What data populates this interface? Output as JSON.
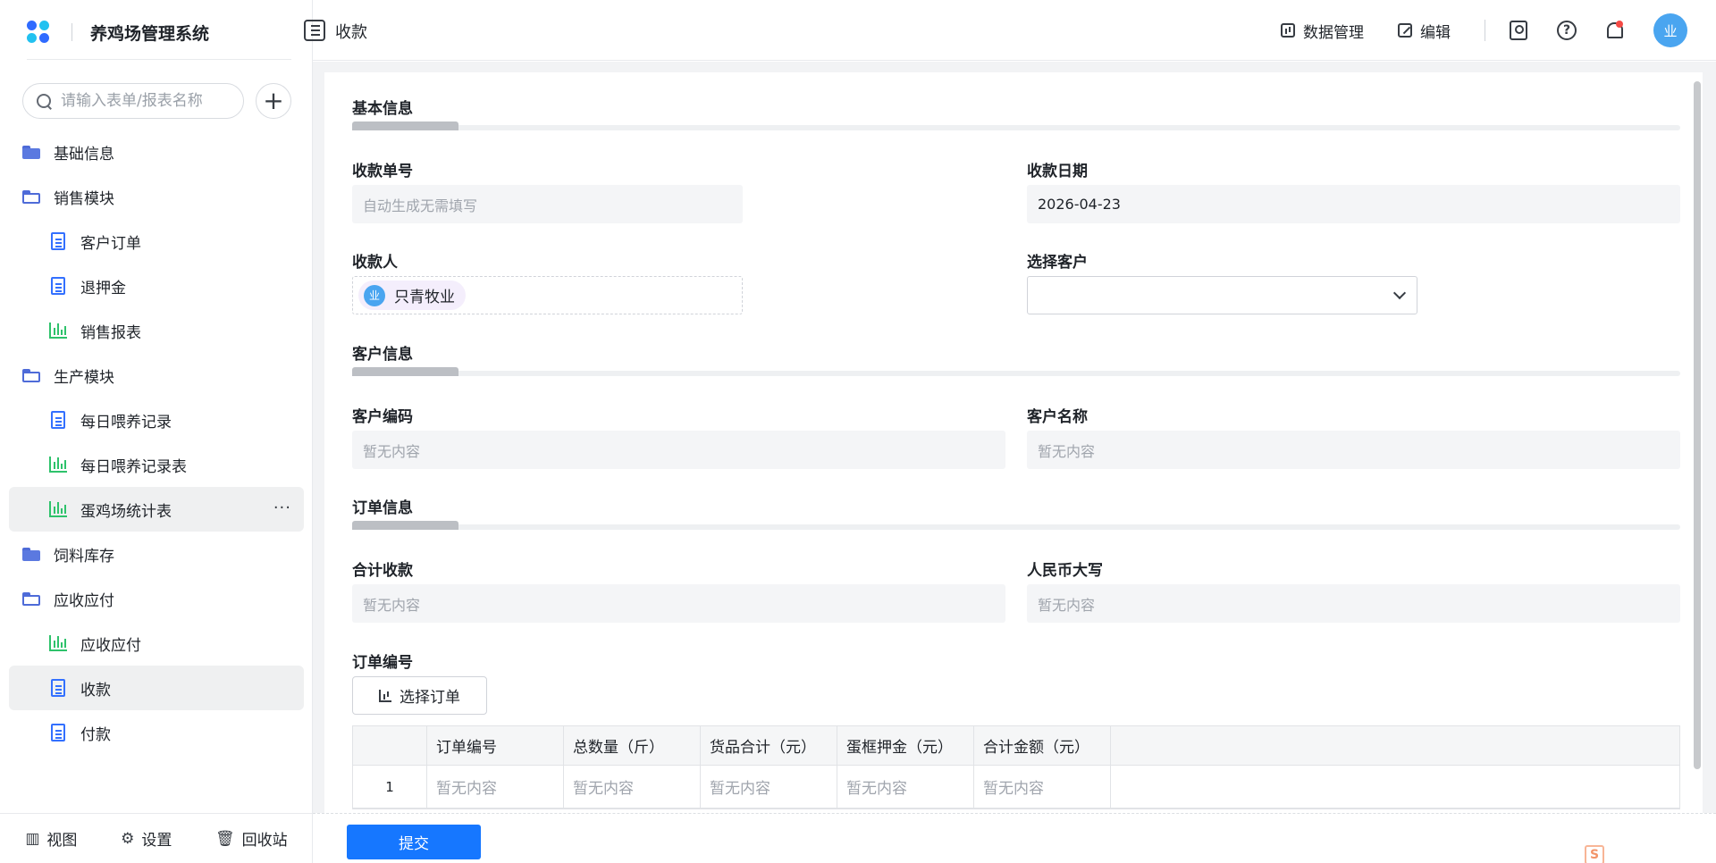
{
  "app": {
    "title": "养鸡场管理系统"
  },
  "search": {
    "placeholder": "请输入表单/报表名称"
  },
  "sidebar": {
    "items": [
      {
        "label": "基础信息",
        "level": 0,
        "icon": "folder-icon"
      },
      {
        "label": "销售模块",
        "level": 0,
        "icon": "folder-open-icon"
      },
      {
        "label": "客户订单",
        "level": 1,
        "icon": "form-doc-icon"
      },
      {
        "label": "退押金",
        "level": 1,
        "icon": "form-doc-icon"
      },
      {
        "label": "销售报表",
        "level": 1,
        "icon": "report-chart-icon"
      },
      {
        "label": "生产模块",
        "level": 0,
        "icon": "folder-open-icon"
      },
      {
        "label": "每日喂养记录",
        "level": 1,
        "icon": "form-doc-icon"
      },
      {
        "label": "每日喂养记录表",
        "level": 1,
        "icon": "report-chart-icon"
      },
      {
        "label": "蛋鸡场统计表",
        "level": 1,
        "icon": "report-chart-icon",
        "hover": true
      },
      {
        "label": "饲料库存",
        "level": 0,
        "icon": "folder-icon"
      },
      {
        "label": "应收应付",
        "level": 0,
        "icon": "folder-open-icon"
      },
      {
        "label": "应收应付",
        "level": 1,
        "icon": "report-chart-icon"
      },
      {
        "label": "收款",
        "level": 1,
        "icon": "form-doc-icon",
        "active": true
      },
      {
        "label": "付款",
        "level": 1,
        "icon": "form-doc-icon"
      }
    ],
    "more_label": "···",
    "bottom": {
      "view": "视图",
      "settings": "设置",
      "recycle": "回收站"
    }
  },
  "header": {
    "page_title": "收款",
    "data_manage": "数据管理",
    "edit": "编辑",
    "help_glyph": "?",
    "avatar_text": "业"
  },
  "form": {
    "basic_section": "基本信息",
    "receipt_no_label": "收款单号",
    "receipt_no_placeholder": "自动生成无需填写",
    "receipt_date_label": "收款日期",
    "receipt_date_value": "2026-04-23",
    "payee_label": "收款人",
    "payee_value": "只青牧业",
    "payee_avatar": "业",
    "customer_select_label": "选择客户",
    "customer_section": "客户信息",
    "customer_code_label": "客户编码",
    "customer_code_value": "暂无内容",
    "customer_name_label": "客户名称",
    "customer_name_value": "暂无内容",
    "order_section": "订单信息",
    "total_label": "合计收款",
    "total_value": "暂无内容",
    "rmb_label": "人民币大写",
    "rmb_value": "暂无内容",
    "order_no_label": "订单编号",
    "select_order_button": "选择订单"
  },
  "table": {
    "columns": [
      "订单编号",
      "总数量（斤）",
      "货品合计（元）",
      "蛋框押金（元）",
      "合计金额（元）"
    ],
    "rows": [
      {
        "index": "1",
        "cells": [
          "暂无内容",
          "暂无内容",
          "暂无内容",
          "暂无内容",
          "暂无内容"
        ]
      }
    ]
  },
  "footer": {
    "submit": "提交"
  },
  "colors": {
    "primary": "#1677ff",
    "active_bg": "#eff0f1",
    "doc_icon": "#3370ff",
    "report_icon": "#2ec26b",
    "folder_icon": "#5b79e0"
  }
}
